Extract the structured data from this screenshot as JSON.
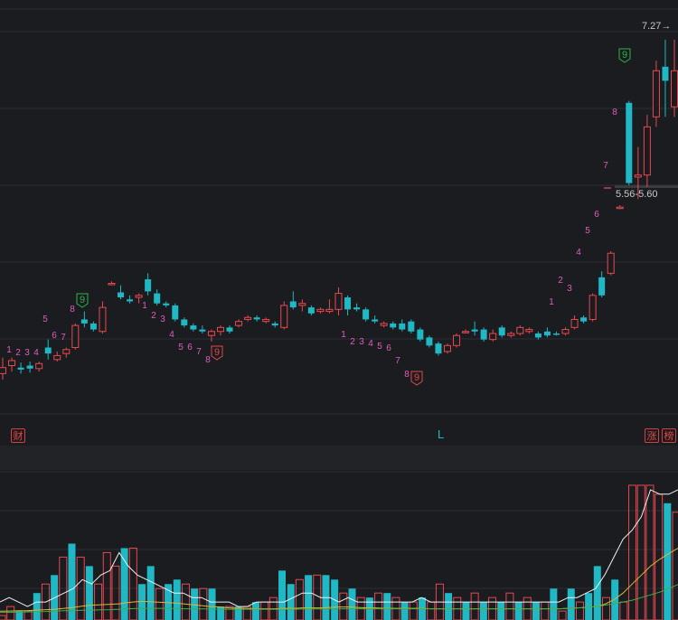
{
  "markers": {
    "fin_tag": "财",
    "limit_up_tag": "涨",
    "rank_tag": "榜",
    "l_mark": "L",
    "high_label": "7.27→",
    "range_label": "5.56-5.60"
  },
  "colors": {
    "background": "#1b1c20",
    "up": "#e8484f",
    "down": "#1fb8c4",
    "td_count": "#e05dbe",
    "ma5": "#f0f0f0",
    "ma10": "#d9b838",
    "ma20": "#3fae4a",
    "grid": "#2c2e33"
  },
  "td_counts": [
    {
      "labels": [
        "1",
        "2",
        "3",
        "4",
        "5",
        "6",
        "7",
        "8",
        "9"
      ],
      "dir": "down"
    },
    {
      "labels": [
        "1",
        "2",
        "3",
        "4",
        "5",
        "6",
        "7",
        "8",
        "9"
      ],
      "dir": "up"
    },
    {
      "labels": [
        "1",
        "2",
        "3",
        "4",
        "5",
        "6",
        "7",
        "8",
        "9"
      ],
      "dir": "up"
    },
    {
      "labels": [
        "1",
        "2",
        "3",
        "4",
        "5",
        "6",
        "7",
        "8",
        "9"
      ],
      "dir": "down"
    }
  ],
  "chart_data": [
    {
      "type": "candlestick",
      "title": "",
      "annotations": [
        "7.27",
        "5.56-5.60"
      ],
      "candles": [
        {
          "o": 4.0,
          "h": 4.1,
          "l": 3.88,
          "c": 3.94,
          "up": true
        },
        {
          "o": 4.02,
          "h": 4.1,
          "l": 3.96,
          "c": 4.07,
          "up": true
        },
        {
          "o": 4.0,
          "h": 4.05,
          "l": 3.94,
          "c": 3.98,
          "up": false
        },
        {
          "o": 3.99,
          "h": 4.06,
          "l": 3.95,
          "c": 4.02,
          "up": false
        },
        {
          "o": 3.99,
          "h": 4.06,
          "l": 3.96,
          "c": 4.04,
          "up": true
        },
        {
          "o": 4.2,
          "h": 4.28,
          "l": 4.08,
          "c": 4.14,
          "up": false
        },
        {
          "o": 4.08,
          "h": 4.16,
          "l": 4.06,
          "c": 4.12,
          "up": true
        },
        {
          "o": 4.14,
          "h": 4.2,
          "l": 4.1,
          "c": 4.18,
          "up": true
        },
        {
          "o": 4.2,
          "h": 4.44,
          "l": 4.18,
          "c": 4.42,
          "up": true
        },
        {
          "o": 4.48,
          "h": 4.56,
          "l": 4.4,
          "c": 4.44,
          "up": false
        },
        {
          "o": 4.44,
          "h": 4.46,
          "l": 4.36,
          "c": 4.38,
          "up": false
        },
        {
          "o": 4.36,
          "h": 4.66,
          "l": 4.34,
          "c": 4.6,
          "up": true
        },
        {
          "o": 4.84,
          "h": 4.86,
          "l": 4.82,
          "c": 4.84,
          "up": true
        },
        {
          "o": 4.75,
          "h": 4.82,
          "l": 4.68,
          "c": 4.7,
          "up": false
        },
        {
          "o": 4.66,
          "h": 4.72,
          "l": 4.64,
          "c": 4.68,
          "up": false
        },
        {
          "o": 4.7,
          "h": 4.74,
          "l": 4.64,
          "c": 4.72,
          "up": true
        },
        {
          "o": 4.88,
          "h": 4.94,
          "l": 4.72,
          "c": 4.76,
          "up": false
        },
        {
          "o": 4.74,
          "h": 4.78,
          "l": 4.62,
          "c": 4.64,
          "up": false
        },
        {
          "o": 4.64,
          "h": 4.66,
          "l": 4.6,
          "c": 4.62,
          "up": false
        },
        {
          "o": 4.62,
          "h": 4.64,
          "l": 4.46,
          "c": 4.48,
          "up": false
        },
        {
          "o": 4.48,
          "h": 4.5,
          "l": 4.4,
          "c": 4.42,
          "up": false
        },
        {
          "o": 4.42,
          "h": 4.44,
          "l": 4.36,
          "c": 4.38,
          "up": false
        },
        {
          "o": 4.38,
          "h": 4.42,
          "l": 4.34,
          "c": 4.36,
          "up": false
        },
        {
          "o": 4.36,
          "h": 4.38,
          "l": 4.26,
          "c": 4.32,
          "up": true
        },
        {
          "o": 4.36,
          "h": 4.42,
          "l": 4.32,
          "c": 4.4,
          "up": true
        },
        {
          "o": 4.4,
          "h": 4.42,
          "l": 4.34,
          "c": 4.36,
          "up": false
        },
        {
          "o": 4.42,
          "h": 4.48,
          "l": 4.4,
          "c": 4.46,
          "up": true
        },
        {
          "o": 4.48,
          "h": 4.52,
          "l": 4.46,
          "c": 4.5,
          "up": true
        },
        {
          "o": 4.5,
          "h": 4.52,
          "l": 4.46,
          "c": 4.48,
          "up": false
        },
        {
          "o": 4.48,
          "h": 4.5,
          "l": 4.44,
          "c": 4.46,
          "up": true
        },
        {
          "o": 4.42,
          "h": 4.46,
          "l": 4.4,
          "c": 4.44,
          "up": false
        },
        {
          "o": 4.4,
          "h": 4.66,
          "l": 4.38,
          "c": 4.62,
          "up": true
        },
        {
          "o": 4.66,
          "h": 4.76,
          "l": 4.58,
          "c": 4.6,
          "up": false
        },
        {
          "o": 4.62,
          "h": 4.68,
          "l": 4.56,
          "c": 4.64,
          "up": true
        },
        {
          "o": 4.6,
          "h": 4.62,
          "l": 4.52,
          "c": 4.54,
          "up": false
        },
        {
          "o": 4.56,
          "h": 4.6,
          "l": 4.54,
          "c": 4.58,
          "up": true
        },
        {
          "o": 4.56,
          "h": 4.68,
          "l": 4.54,
          "c": 4.58,
          "up": true
        },
        {
          "o": 4.58,
          "h": 4.8,
          "l": 4.52,
          "c": 4.74,
          "up": true
        },
        {
          "o": 4.7,
          "h": 4.72,
          "l": 4.52,
          "c": 4.58,
          "up": false
        },
        {
          "o": 4.6,
          "h": 4.64,
          "l": 4.56,
          "c": 4.58,
          "up": false
        },
        {
          "o": 4.58,
          "h": 4.6,
          "l": 4.46,
          "c": 4.48,
          "up": false
        },
        {
          "o": 4.48,
          "h": 4.52,
          "l": 4.44,
          "c": 4.46,
          "up": false
        },
        {
          "o": 4.44,
          "h": 4.46,
          "l": 4.4,
          "c": 4.42,
          "up": true
        },
        {
          "o": 4.44,
          "h": 4.46,
          "l": 4.38,
          "c": 4.4,
          "up": false
        },
        {
          "o": 4.44,
          "h": 4.48,
          "l": 4.36,
          "c": 4.38,
          "up": false
        },
        {
          "o": 4.46,
          "h": 4.48,
          "l": 4.34,
          "c": 4.36,
          "up": false
        },
        {
          "o": 4.38,
          "h": 4.4,
          "l": 4.26,
          "c": 4.28,
          "up": false
        },
        {
          "o": 4.3,
          "h": 4.32,
          "l": 4.2,
          "c": 4.22,
          "up": false
        },
        {
          "o": 4.24,
          "h": 4.26,
          "l": 4.12,
          "c": 4.14,
          "up": false
        },
        {
          "o": 4.16,
          "h": 4.24,
          "l": 4.14,
          "c": 4.22,
          "up": true
        },
        {
          "o": 4.22,
          "h": 4.34,
          "l": 4.2,
          "c": 4.32,
          "up": true
        },
        {
          "o": 4.36,
          "h": 4.38,
          "l": 4.34,
          "c": 4.36,
          "up": true
        },
        {
          "o": 4.36,
          "h": 4.46,
          "l": 4.32,
          "c": 4.38,
          "up": false
        },
        {
          "o": 4.38,
          "h": 4.4,
          "l": 4.26,
          "c": 4.28,
          "up": false
        },
        {
          "o": 4.28,
          "h": 4.38,
          "l": 4.26,
          "c": 4.34,
          "up": true
        },
        {
          "o": 4.4,
          "h": 4.42,
          "l": 4.3,
          "c": 4.32,
          "up": false
        },
        {
          "o": 4.34,
          "h": 4.36,
          "l": 4.3,
          "c": 4.32,
          "up": true
        },
        {
          "o": 4.34,
          "h": 4.42,
          "l": 4.32,
          "c": 4.4,
          "up": true
        },
        {
          "o": 4.38,
          "h": 4.4,
          "l": 4.34,
          "c": 4.36,
          "up": true
        },
        {
          "o": 4.34,
          "h": 4.36,
          "l": 4.28,
          "c": 4.3,
          "up": false
        },
        {
          "o": 4.32,
          "h": 4.4,
          "l": 4.3,
          "c": 4.36,
          "up": false
        },
        {
          "o": 4.34,
          "h": 4.36,
          "l": 4.32,
          "c": 4.34,
          "up": false
        },
        {
          "o": 4.34,
          "h": 4.4,
          "l": 4.32,
          "c": 4.38,
          "up": true
        },
        {
          "o": 4.4,
          "h": 4.52,
          "l": 4.38,
          "c": 4.48,
          "up": true
        },
        {
          "o": 4.5,
          "h": 4.52,
          "l": 4.44,
          "c": 4.46,
          "up": false
        },
        {
          "o": 4.48,
          "h": 4.74,
          "l": 4.46,
          "c": 4.72,
          "up": true
        },
        {
          "o": 4.72,
          "h": 4.96,
          "l": 4.7,
          "c": 4.9,
          "up": false
        },
        {
          "o": 4.94,
          "h": 5.16,
          "l": 4.92,
          "c": 5.14,
          "up": true
        },
        {
          "o": 5.6,
          "h": 5.62,
          "l": 5.58,
          "c": 5.6,
          "up": true
        },
        {
          "o": 6.64,
          "h": 6.66,
          "l": 5.82,
          "c": 5.84,
          "up": false
        },
        {
          "o": 5.9,
          "h": 6.2,
          "l": 5.68,
          "c": 5.92,
          "up": true
        },
        {
          "o": 5.92,
          "h": 6.52,
          "l": 5.8,
          "c": 6.4,
          "up": true
        },
        {
          "o": 6.5,
          "h": 7.06,
          "l": 6.4,
          "c": 6.96,
          "up": true
        },
        {
          "o": 6.86,
          "h": 7.27,
          "l": 6.5,
          "c": 7.0,
          "up": false
        },
        {
          "o": 6.96,
          "h": 7.27,
          "l": 6.5,
          "c": 6.6,
          "up": true
        }
      ],
      "ylim": [
        3.7,
        7.35
      ]
    },
    {
      "type": "bar",
      "title": "",
      "series": [
        {
          "values": [
            4,
            5,
            4,
            3,
            4,
            4,
            5,
            6,
            7,
            9,
            8,
            10,
            11,
            15,
            12,
            10,
            9,
            8,
            7,
            6,
            6,
            5,
            5,
            4,
            4,
            4,
            3,
            3,
            4,
            4,
            4,
            4,
            5,
            6,
            6,
            5,
            5,
            4,
            5,
            4,
            4,
            4,
            4,
            4,
            4,
            4,
            5,
            4,
            4,
            4,
            4,
            4,
            4,
            4,
            4,
            4,
            4,
            4,
            4,
            4,
            4,
            4,
            5,
            5,
            6,
            7,
            10,
            14,
            18,
            20,
            23,
            29,
            28,
            28,
            29
          ]
        },
        {
          "values": [
            1.95,
            2.0,
            2.05,
            2.1,
            2.2,
            2.3,
            2.4,
            2.6,
            2.8,
            3.1,
            3.3,
            3.4,
            3.5,
            3.6,
            3.9,
            4.1,
            4.1,
            4.0,
            3.9,
            3.8,
            3.6,
            3.4,
            3.2,
            3.0,
            2.9,
            2.7,
            2.6,
            2.6,
            2.5,
            2.5,
            2.5,
            2.6,
            2.6,
            2.7,
            2.7,
            2.7,
            2.8,
            2.9,
            2.9,
            2.8,
            2.7,
            2.7,
            2.6,
            2.6,
            2.6,
            2.6,
            2.6,
            2.5,
            2.5,
            2.5,
            2.5,
            2.5,
            2.5,
            2.5,
            2.5,
            2.5,
            2.5,
            2.5,
            2.5,
            2.5,
            2.5,
            2.5,
            2.6,
            2.7,
            2.8,
            3.0,
            3.5,
            4.5,
            6.0,
            8.0,
            10.0,
            12.0,
            13.5,
            14.8,
            16.0
          ]
        },
        {
          "values": [
            1.7,
            1.7,
            1.75,
            1.8,
            1.85,
            1.9,
            2.0,
            2.05,
            2.1,
            2.15,
            2.2,
            2.25,
            2.3,
            2.4,
            2.5,
            2.55,
            2.6,
            2.6,
            2.6,
            2.55,
            2.5,
            2.5,
            2.45,
            2.45,
            2.4,
            2.4,
            2.4,
            2.4,
            2.4,
            2.4,
            2.4,
            2.4,
            2.4,
            2.45,
            2.45,
            2.45,
            2.45,
            2.45,
            2.5,
            2.5,
            2.5,
            2.5,
            2.5,
            2.5,
            2.5,
            2.5,
            2.5,
            2.5,
            2.5,
            2.5,
            2.5,
            2.5,
            2.5,
            2.5,
            2.5,
            2.5,
            2.5,
            2.5,
            2.5,
            2.5,
            2.5,
            2.5,
            2.6,
            2.7,
            2.8,
            3.0,
            3.3,
            3.6,
            4.0,
            4.4,
            5.0,
            5.6,
            6.2,
            7.0,
            7.9
          ]
        }
      ],
      "values": [
        1,
        3,
        2,
        2,
        6,
        8,
        10,
        14,
        17,
        14,
        12,
        8,
        15,
        12,
        16,
        16,
        8,
        12,
        7,
        8,
        9,
        8,
        7,
        7,
        7,
        3,
        3,
        3,
        3,
        4,
        4,
        5,
        11,
        8,
        9,
        10,
        10,
        10,
        9,
        6,
        7,
        5,
        5,
        6,
        6,
        5,
        4,
        4,
        5,
        4,
        8,
        6,
        5,
        4,
        6,
        4,
        5,
        4,
        6,
        4,
        5,
        4,
        4,
        7,
        2,
        7,
        4,
        6,
        12,
        5,
        9,
        4,
        30,
        30,
        30,
        28,
        26,
        24
      ],
      "colors": [
        "up",
        "up",
        "down",
        "up",
        "down",
        "up",
        "down",
        "up",
        "down",
        "up",
        "down",
        "up",
        "up",
        "up",
        "down",
        "up",
        "down",
        "down",
        "up",
        "down",
        "down",
        "up",
        "down",
        "up",
        "down",
        "down",
        "up",
        "down",
        "up",
        "down",
        "up",
        "up",
        "down",
        "down",
        "up",
        "down",
        "up",
        "down",
        "down",
        "up",
        "down",
        "up",
        "down",
        "up",
        "down",
        "up",
        "down",
        "up",
        "down",
        "up",
        "up",
        "down",
        "up",
        "down",
        "up",
        "down",
        "up",
        "down",
        "up",
        "down",
        "up",
        "down",
        "up",
        "down",
        "up",
        "down",
        "up",
        "down",
        "down",
        "up",
        "down",
        "up",
        "up",
        "up",
        "up",
        "up",
        "down",
        "up"
      ],
      "ylim": [
        0,
        33
      ]
    }
  ]
}
